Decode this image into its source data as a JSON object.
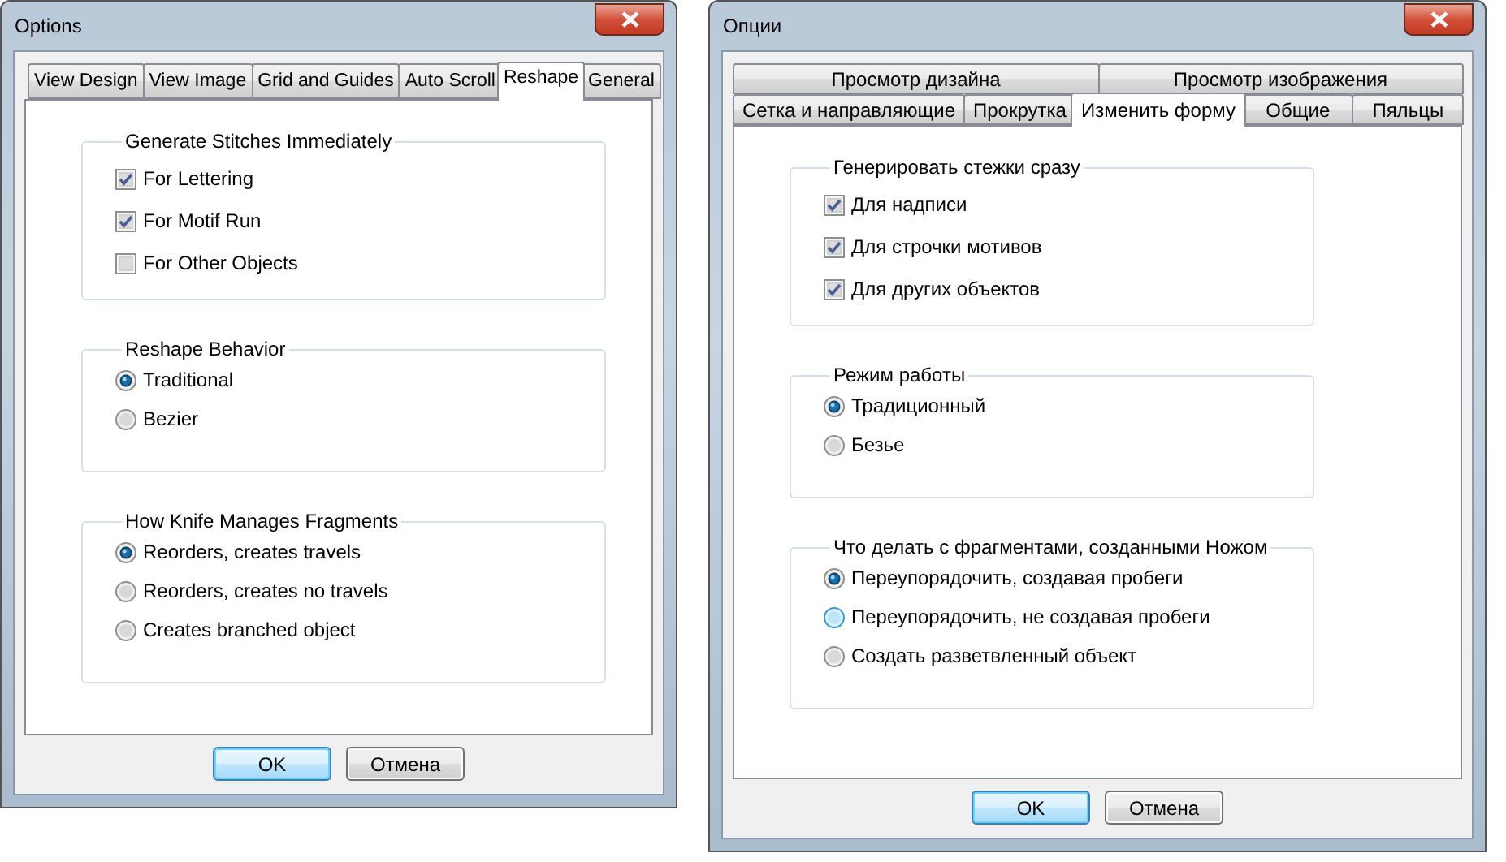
{
  "dialogs": [
    {
      "title": "Options",
      "tab_rows": [
        [
          {
            "label": "View Design",
            "selected": false
          },
          {
            "label": "View Image",
            "selected": false
          },
          {
            "label": "Grid and Guides",
            "selected": false
          },
          {
            "label": "Auto Scroll",
            "selected": false
          },
          {
            "label": "Reshape",
            "selected": true
          },
          {
            "label": "General",
            "selected": false
          }
        ]
      ],
      "groups": [
        {
          "title": "Generate Stitches Immediately",
          "kind": "checkbox",
          "options": [
            {
              "label": "For Lettering",
              "checked": true,
              "hovered": false
            },
            {
              "label": "For Motif Run",
              "checked": true,
              "hovered": false
            },
            {
              "label": "For Other Objects",
              "checked": false,
              "hovered": false
            }
          ]
        },
        {
          "title": "Reshape Behavior",
          "kind": "radio",
          "options": [
            {
              "label": "Traditional",
              "checked": true,
              "hovered": false
            },
            {
              "label": "Bezier",
              "checked": false,
              "hovered": false
            }
          ]
        },
        {
          "title": "How Knife Manages Fragments",
          "kind": "radio",
          "options": [
            {
              "label": "Reorders, creates travels",
              "checked": true,
              "hovered": false
            },
            {
              "label": "Reorders, creates no travels",
              "checked": false,
              "hovered": false
            },
            {
              "label": "Creates branched object",
              "checked": false,
              "hovered": false
            }
          ]
        }
      ],
      "buttons": [
        {
          "label": "OK",
          "default": true
        },
        {
          "label": "Отмена",
          "default": false
        }
      ]
    },
    {
      "title": "Опции",
      "tab_rows": [
        [
          {
            "label": "Просмотр дизайна",
            "selected": false
          },
          {
            "label": "Просмотр изображения",
            "selected": false
          }
        ],
        [
          {
            "label": "Сетка и направляющие",
            "selected": false
          },
          {
            "label": "Прокрутка",
            "selected": false
          },
          {
            "label": "Изменить форму",
            "selected": true
          },
          {
            "label": "Общие",
            "selected": false
          },
          {
            "label": "Пяльцы",
            "selected": false
          }
        ]
      ],
      "groups": [
        {
          "title": "Генерировать стежки сразу",
          "kind": "checkbox",
          "options": [
            {
              "label": "Для надписи",
              "checked": true,
              "hovered": false
            },
            {
              "label": "Для строчки мотивов",
              "checked": true,
              "hovered": false
            },
            {
              "label": "Для других объектов",
              "checked": true,
              "hovered": false
            }
          ]
        },
        {
          "title": "Режим работы",
          "kind": "radio",
          "options": [
            {
              "label": "Традиционный",
              "checked": true,
              "hovered": false
            },
            {
              "label": "Безье",
              "checked": false,
              "hovered": false
            }
          ]
        },
        {
          "title": "Что делать с фрагментами, созданными Ножом",
          "kind": "radio",
          "options": [
            {
              "label": "Переупорядочить, создавая пробеги",
              "checked": true,
              "hovered": false
            },
            {
              "label": "Переупорядочить, не создавая пробеги",
              "checked": false,
              "hovered": true
            },
            {
              "label": "Создать разветвленный объект",
              "checked": false,
              "hovered": false
            }
          ]
        }
      ],
      "buttons": [
        {
          "label": "OK",
          "default": true
        },
        {
          "label": "Отмена",
          "default": false
        }
      ]
    }
  ]
}
